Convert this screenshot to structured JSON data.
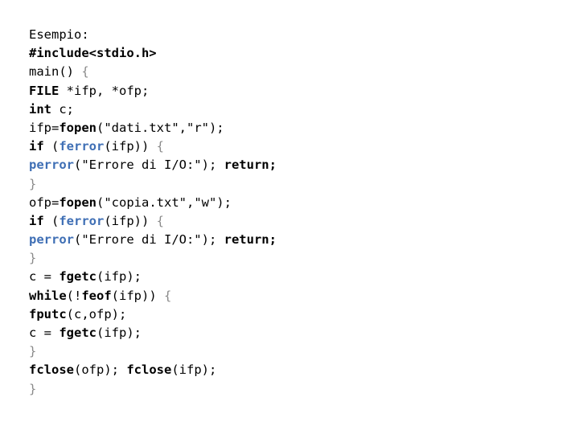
{
  "slide": {
    "title": "Esempio:",
    "language": "C",
    "background_color": "#ffffff",
    "colors": {
      "text": "#000000",
      "highlight_function": "#3f6fb5",
      "brace_gray": "#8a8a8a"
    },
    "code_lines": [
      {
        "index": 0,
        "text": "Esempio:",
        "tokens": [
          {
            "text": "Esempio:",
            "weight": "normal",
            "color": "black"
          }
        ]
      },
      {
        "index": 1,
        "text": "#include<stdio.h>",
        "tokens": [
          {
            "text": "#include<stdio.h>",
            "weight": "bold",
            "color": "black"
          }
        ]
      },
      {
        "index": 2,
        "text": "main() {",
        "tokens": [
          {
            "text": "main() ",
            "weight": "normal",
            "color": "black"
          },
          {
            "text": "{",
            "weight": "normal",
            "color": "gray"
          }
        ]
      },
      {
        "index": 3,
        "text": "FILE *ifp, *ofp;",
        "tokens": [
          {
            "text": "FILE",
            "weight": "bold",
            "color": "black"
          },
          {
            "text": " *ifp, *ofp;",
            "weight": "normal",
            "color": "black"
          }
        ]
      },
      {
        "index": 4,
        "text": "int c;",
        "tokens": [
          {
            "text": "int",
            "weight": "bold",
            "color": "black"
          },
          {
            "text": " c;",
            "weight": "normal",
            "color": "black"
          }
        ]
      },
      {
        "index": 5,
        "text": "ifp=fopen(\"dati.txt\",\"r\");",
        "tokens": [
          {
            "text": "ifp=",
            "weight": "normal",
            "color": "black"
          },
          {
            "text": "fopen",
            "weight": "bold",
            "color": "black"
          },
          {
            "text": "(\"dati.txt\",\"r\");",
            "weight": "normal",
            "color": "black"
          }
        ]
      },
      {
        "index": 6,
        "text": "if (ferror(ifp)) {",
        "tokens": [
          {
            "text": "if",
            "weight": "bold",
            "color": "black"
          },
          {
            "text": " (",
            "weight": "normal",
            "color": "black"
          },
          {
            "text": "ferror",
            "weight": "bold",
            "color": "blue"
          },
          {
            "text": "(ifp)) ",
            "weight": "normal",
            "color": "black"
          },
          {
            "text": "{",
            "weight": "normal",
            "color": "gray"
          }
        ]
      },
      {
        "index": 7,
        "text": "perror(\"Errore di I/O:\"); return;",
        "tokens": [
          {
            "text": "perror",
            "weight": "bold",
            "color": "blue"
          },
          {
            "text": "(\"Errore di I/O:\"); ",
            "weight": "normal",
            "color": "black"
          },
          {
            "text": "return;",
            "weight": "bold",
            "color": "black"
          }
        ]
      },
      {
        "index": 8,
        "text": "}",
        "tokens": [
          {
            "text": "}",
            "weight": "normal",
            "color": "gray"
          }
        ]
      },
      {
        "index": 9,
        "text": "ofp=fopen(\"copia.txt\",\"w\");",
        "tokens": [
          {
            "text": "ofp=",
            "weight": "normal",
            "color": "black"
          },
          {
            "text": "fopen",
            "weight": "bold",
            "color": "black"
          },
          {
            "text": "(\"copia.txt\",\"w\");",
            "weight": "normal",
            "color": "black"
          }
        ]
      },
      {
        "index": 10,
        "text": "if (ferror(ifp)) {",
        "tokens": [
          {
            "text": "if",
            "weight": "bold",
            "color": "black"
          },
          {
            "text": " (",
            "weight": "normal",
            "color": "black"
          },
          {
            "text": "ferror",
            "weight": "bold",
            "color": "blue"
          },
          {
            "text": "(ifp)) ",
            "weight": "normal",
            "color": "black"
          },
          {
            "text": "{",
            "weight": "normal",
            "color": "gray"
          }
        ]
      },
      {
        "index": 11,
        "text": "perror(\"Errore di I/O:\"); return;",
        "tokens": [
          {
            "text": "perror",
            "weight": "bold",
            "color": "blue"
          },
          {
            "text": "(\"Errore di I/O:\"); ",
            "weight": "normal",
            "color": "black"
          },
          {
            "text": "return;",
            "weight": "bold",
            "color": "black"
          }
        ]
      },
      {
        "index": 12,
        "text": "}",
        "tokens": [
          {
            "text": "}",
            "weight": "normal",
            "color": "gray"
          }
        ]
      },
      {
        "index": 13,
        "text": "c = fgetc(ifp);",
        "tokens": [
          {
            "text": "c = ",
            "weight": "normal",
            "color": "black"
          },
          {
            "text": "fgetc",
            "weight": "bold",
            "color": "black"
          },
          {
            "text": "(ifp);",
            "weight": "normal",
            "color": "black"
          }
        ]
      },
      {
        "index": 14,
        "text": "while(!feof(ifp)) {",
        "tokens": [
          {
            "text": "while",
            "weight": "bold",
            "color": "black"
          },
          {
            "text": "(!",
            "weight": "normal",
            "color": "black"
          },
          {
            "text": "feof",
            "weight": "bold",
            "color": "black"
          },
          {
            "text": "(ifp)) ",
            "weight": "normal",
            "color": "black"
          },
          {
            "text": "{",
            "weight": "normal",
            "color": "gray"
          }
        ]
      },
      {
        "index": 15,
        "text": "fputc(c,ofp);",
        "tokens": [
          {
            "text": "fputc",
            "weight": "bold",
            "color": "black"
          },
          {
            "text": "(c,ofp);",
            "weight": "normal",
            "color": "black"
          }
        ]
      },
      {
        "index": 16,
        "text": "c = fgetc(ifp);",
        "tokens": [
          {
            "text": "c = ",
            "weight": "normal",
            "color": "black"
          },
          {
            "text": "fgetc",
            "weight": "bold",
            "color": "black"
          },
          {
            "text": "(ifp);",
            "weight": "normal",
            "color": "black"
          }
        ]
      },
      {
        "index": 17,
        "text": "}",
        "tokens": [
          {
            "text": "}",
            "weight": "normal",
            "color": "gray"
          }
        ]
      },
      {
        "index": 18,
        "text": "fclose(ofp); fclose(ifp);",
        "tokens": [
          {
            "text": "fclose",
            "weight": "bold",
            "color": "black"
          },
          {
            "text": "(ofp); ",
            "weight": "normal",
            "color": "black"
          },
          {
            "text": "fclose",
            "weight": "bold",
            "color": "black"
          },
          {
            "text": "(ifp);",
            "weight": "normal",
            "color": "black"
          }
        ]
      },
      {
        "index": 19,
        "text": "}",
        "tokens": [
          {
            "text": "}",
            "weight": "normal",
            "color": "gray"
          }
        ]
      }
    ]
  }
}
